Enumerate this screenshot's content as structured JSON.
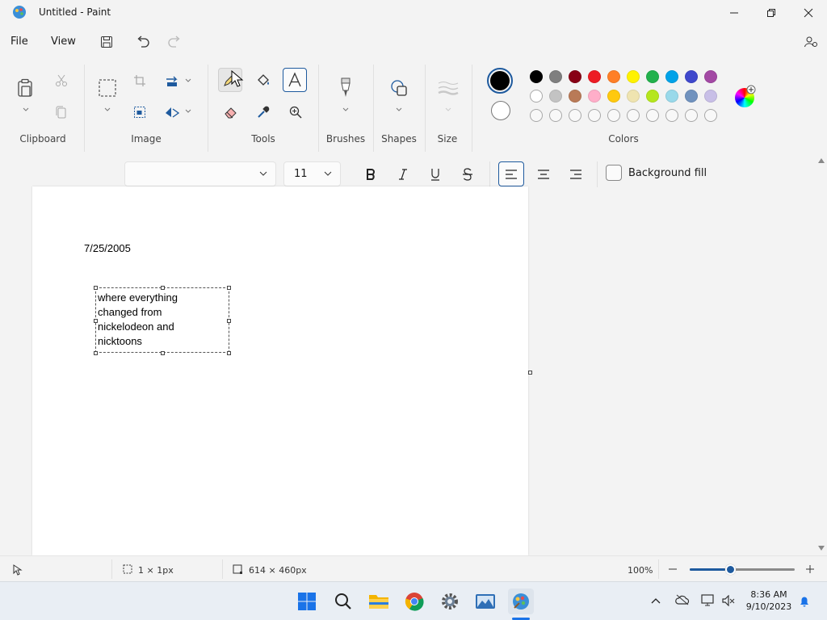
{
  "window": {
    "title": "Untitled - Paint"
  },
  "menu": {
    "file": "File",
    "view": "View"
  },
  "ribbon": {
    "groups": {
      "clipboard": "Clipboard",
      "image": "Image",
      "tools": "Tools",
      "brushes": "Brushes",
      "shapes": "Shapes",
      "size": "Size",
      "colors": "Colors"
    },
    "color1": "#000000",
    "color2": "#ffffff",
    "palette_row1": [
      "#000000",
      "#7f7f7f",
      "#880015",
      "#ed1c24",
      "#ff7f27",
      "#fff200",
      "#22b14c",
      "#00a2e8",
      "#3f48cc",
      "#a349a4"
    ],
    "palette_row2": [
      "#ffffff",
      "#c3c3c3",
      "#b97a57",
      "#ffaec9",
      "#ffc90e",
      "#efe4b0",
      "#b5e61d",
      "#99d9ea",
      "#7092be",
      "#c8bfe7"
    ],
    "palette_row3_empty": 10
  },
  "text_toolbar": {
    "font_family": "",
    "font_size": "11",
    "background_fill": "Background fill"
  },
  "canvas": {
    "date_text": "7/25/2005",
    "textbox_lines": [
      "where everything",
      "changed from",
      "nickelodeon and",
      "nicktoons"
    ]
  },
  "status": {
    "selection": "1 × 1px",
    "canvas_size": "614 × 460px",
    "zoom": "100%"
  },
  "taskbar": {
    "time": "8:36 AM",
    "date": "9/10/2023"
  }
}
